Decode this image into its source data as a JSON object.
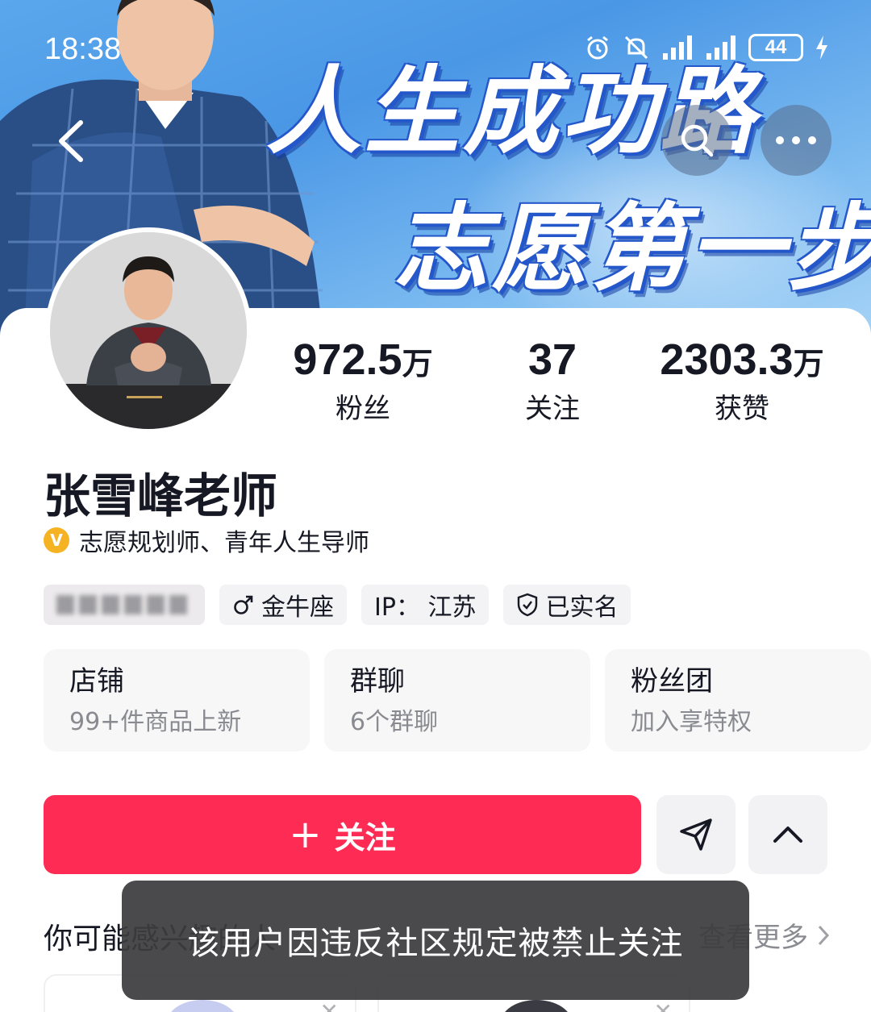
{
  "status_bar": {
    "time": "18:38",
    "battery": "44",
    "icons": [
      "alarm-icon",
      "mute-icon",
      "signal-icon",
      "signal-icon",
      "battery-icon",
      "charging-icon"
    ]
  },
  "banner": {
    "slogan_line1": "人生成功路",
    "slogan_line2": "志愿第一步"
  },
  "profile": {
    "username": "张雪峰老师",
    "verify_badge": "V",
    "verify_text": "志愿规划师、青年人生导师",
    "stats": [
      {
        "num": "972.5",
        "unit": "万",
        "label": "粉丝"
      },
      {
        "num": "37",
        "unit": "",
        "label": "关注"
      },
      {
        "num": "2303.3",
        "unit": "万",
        "label": "获赞"
      }
    ],
    "tags": {
      "zodiac": "金牛座",
      "ip": "IP：  江苏",
      "realname": "已实名"
    }
  },
  "features": [
    {
      "title": "店铺",
      "subtitle": "99+件商品上新"
    },
    {
      "title": "群聊",
      "subtitle": "6个群聊"
    },
    {
      "title": "粉丝团",
      "subtitle": "加入享特权"
    }
  ],
  "actions": {
    "follow_label": "关注",
    "follow_plus": "+"
  },
  "suggestions": {
    "title": "你可能感兴趣的人",
    "more_label": "查看更多"
  },
  "toast": {
    "message": "该用户因违反社区规定被禁止关注"
  },
  "colors": {
    "accent": "#fe2c55",
    "verify_badge": "#f5b323",
    "banner_blue": "#4a97e6"
  }
}
